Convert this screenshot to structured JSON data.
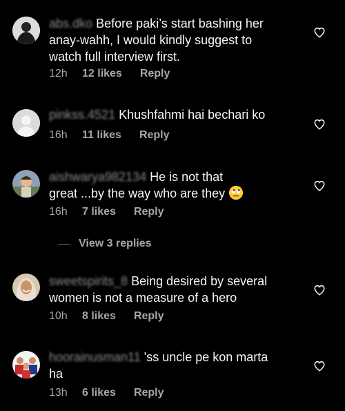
{
  "comments": [
    {
      "username": "abs.dko",
      "text_line1": "Before paki’s start bashing her",
      "text_line2": "anay-wahh, I would kindly suggest to",
      "text_line3": "watch full interview first.",
      "time": "12h",
      "likes": "12 likes",
      "reply": "Reply",
      "avatar": "avatar-dark-figure"
    },
    {
      "username": "pinkss.4521",
      "text_line1": "Khushfahmi hai bechari ko",
      "time": "16h",
      "likes": "11 likes",
      "reply": "Reply",
      "avatar": "avatar-default-gray"
    },
    {
      "username": "aishwarya982134",
      "text_line1": "He is not that",
      "text_line2": "great ...by the way who are they",
      "emoji": "face-with-rolling-eyes",
      "time": "16h",
      "likes": "7 likes",
      "reply": "Reply",
      "avatar": "avatar-child-photo"
    },
    {
      "username": "sweetspirits_8",
      "text_line1": "Being desired by several",
      "text_line2": "women is not a measure of a hero",
      "time": "10h",
      "likes": "8 likes",
      "reply": "Reply",
      "avatar": "avatar-woman-hijab"
    },
    {
      "username": "hoorainusman11",
      "text_line1": "'ss uncle pe kon marta",
      "text_line2": "ha",
      "time": "13h",
      "likes": "6 likes",
      "reply": "Reply",
      "avatar": "avatar-group-photo"
    }
  ],
  "view_replies": "View 3 replies",
  "colors": {
    "background": "#000000",
    "text": "#f5f5f5",
    "muted": "#a8a8a8"
  },
  "icons": {
    "like": "heart-outline-icon"
  }
}
